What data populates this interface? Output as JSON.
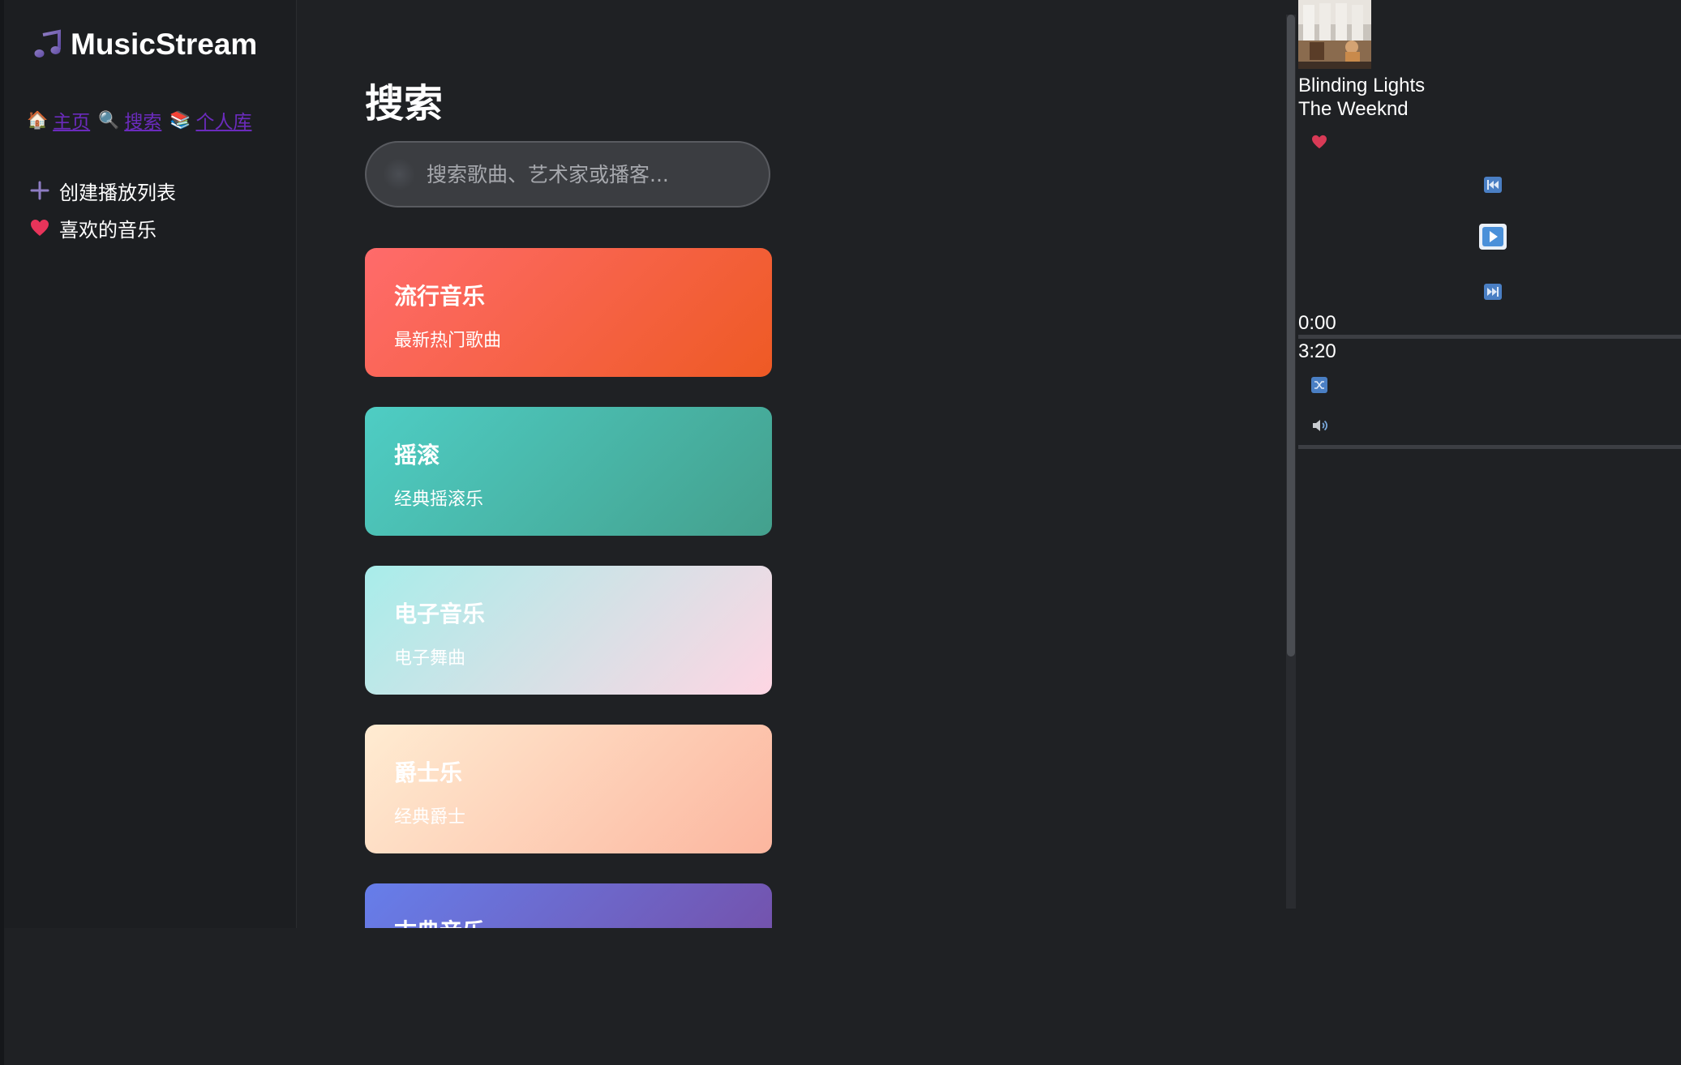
{
  "app": {
    "name": "MusicStream"
  },
  "nav": {
    "items": [
      {
        "label": "主页",
        "icon": "house-icon",
        "emoji": "🏠"
      },
      {
        "label": "搜索",
        "icon": "search-icon",
        "emoji": "🔍"
      },
      {
        "label": "个人库",
        "icon": "library-icon",
        "emoji": "📚"
      }
    ],
    "link_color": "#6b2bbd"
  },
  "sidebar": {
    "actions": [
      {
        "label": "创建播放列表",
        "icon": "plus-icon"
      },
      {
        "label": "喜欢的音乐",
        "icon": "heart-icon"
      }
    ]
  },
  "main": {
    "title": "搜索",
    "search": {
      "placeholder": "搜索歌曲、艺术家或播客...",
      "value": ""
    },
    "categories": [
      {
        "title": "流行音乐",
        "subtitle": "最新热门歌曲",
        "gradient": [
          "#ff6b6b",
          "#ee5a24"
        ],
        "text_color": "#ffffff"
      },
      {
        "title": "摇滚",
        "subtitle": "经典摇滚乐",
        "gradient": [
          "#4ecdc4",
          "#44a08d"
        ],
        "text_color": "#ffffff"
      },
      {
        "title": "电子音乐",
        "subtitle": "电子舞曲",
        "gradient": [
          "#a8edea",
          "#fed6e3"
        ],
        "text_color": "#ffffff"
      },
      {
        "title": "爵士乐",
        "subtitle": "经典爵士",
        "gradient": [
          "#ffecd2",
          "#fcb69f"
        ],
        "text_color": "#ffffff"
      },
      {
        "title": "古典音乐",
        "subtitle": "",
        "gradient": [
          "#667eea",
          "#764ba2"
        ],
        "text_color": "#ffffff"
      }
    ]
  },
  "player": {
    "track_title": "Blinding Lights",
    "artist": "The Weeknd",
    "time_current": "0:00",
    "time_total": "3:20",
    "progress": 0,
    "volume": 0,
    "liked": true,
    "controls": {
      "previous": "previous-icon",
      "play": "play-icon",
      "next": "next-icon",
      "shuffle": "shuffle-icon",
      "volume": "volume-icon"
    },
    "accent": "#4a90d9"
  }
}
